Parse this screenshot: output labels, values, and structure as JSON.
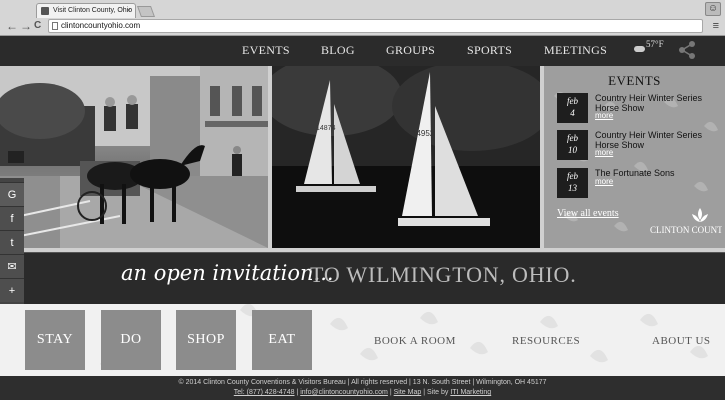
{
  "browser": {
    "tab_title": "Visit Clinton County, Ohio",
    "tab_close": "×",
    "url": "clintoncountyohio.com",
    "back": "←",
    "forward": "→",
    "reload": "C",
    "menu": "≡",
    "user": "☺"
  },
  "nav": {
    "items": [
      "EVENTS",
      "BLOG",
      "GROUPS",
      "SPORTS",
      "MEETINGS"
    ],
    "temperature": "57°F"
  },
  "events": {
    "title": "EVENTS",
    "list": [
      {
        "month": "feb",
        "day": "4",
        "name": "Country Heir Winter Series Horse Show",
        "more": "more"
      },
      {
        "month": "feb",
        "day": "10",
        "name": "Country Heir Winter Series Horse Show",
        "more": "more"
      },
      {
        "month": "feb",
        "day": "13",
        "name": "The Fortunate Sons",
        "more": "more"
      }
    ],
    "view_all": "View all events",
    "logo_text": "CLINTON COUNTY"
  },
  "banner": {
    "script": "an open invitation...",
    "caps": "TO WILMINGTON, OHIO."
  },
  "social": [
    "G",
    "f",
    "t",
    "✉",
    "+"
  ],
  "boxes": [
    "STAY",
    "DO",
    "SHOP",
    "EAT"
  ],
  "links": [
    "BOOK A ROOM",
    "RESOURCES",
    "ABOUT US"
  ],
  "footer": {
    "line1": "© 2014 Clinton County Conventions & Visitors Bureau | All rights reserved | 13 N. South Street | Wilmington, OH 45177",
    "phone": "Tel: (877) 428-4748",
    "email": "info@clintoncountyohio.com",
    "sitemap": "Site Map",
    "site_by_prefix": "Site by",
    "site_by": "ITI Marketing",
    "sep": "|"
  },
  "sail_numbers": [
    "14874",
    "14952"
  ]
}
